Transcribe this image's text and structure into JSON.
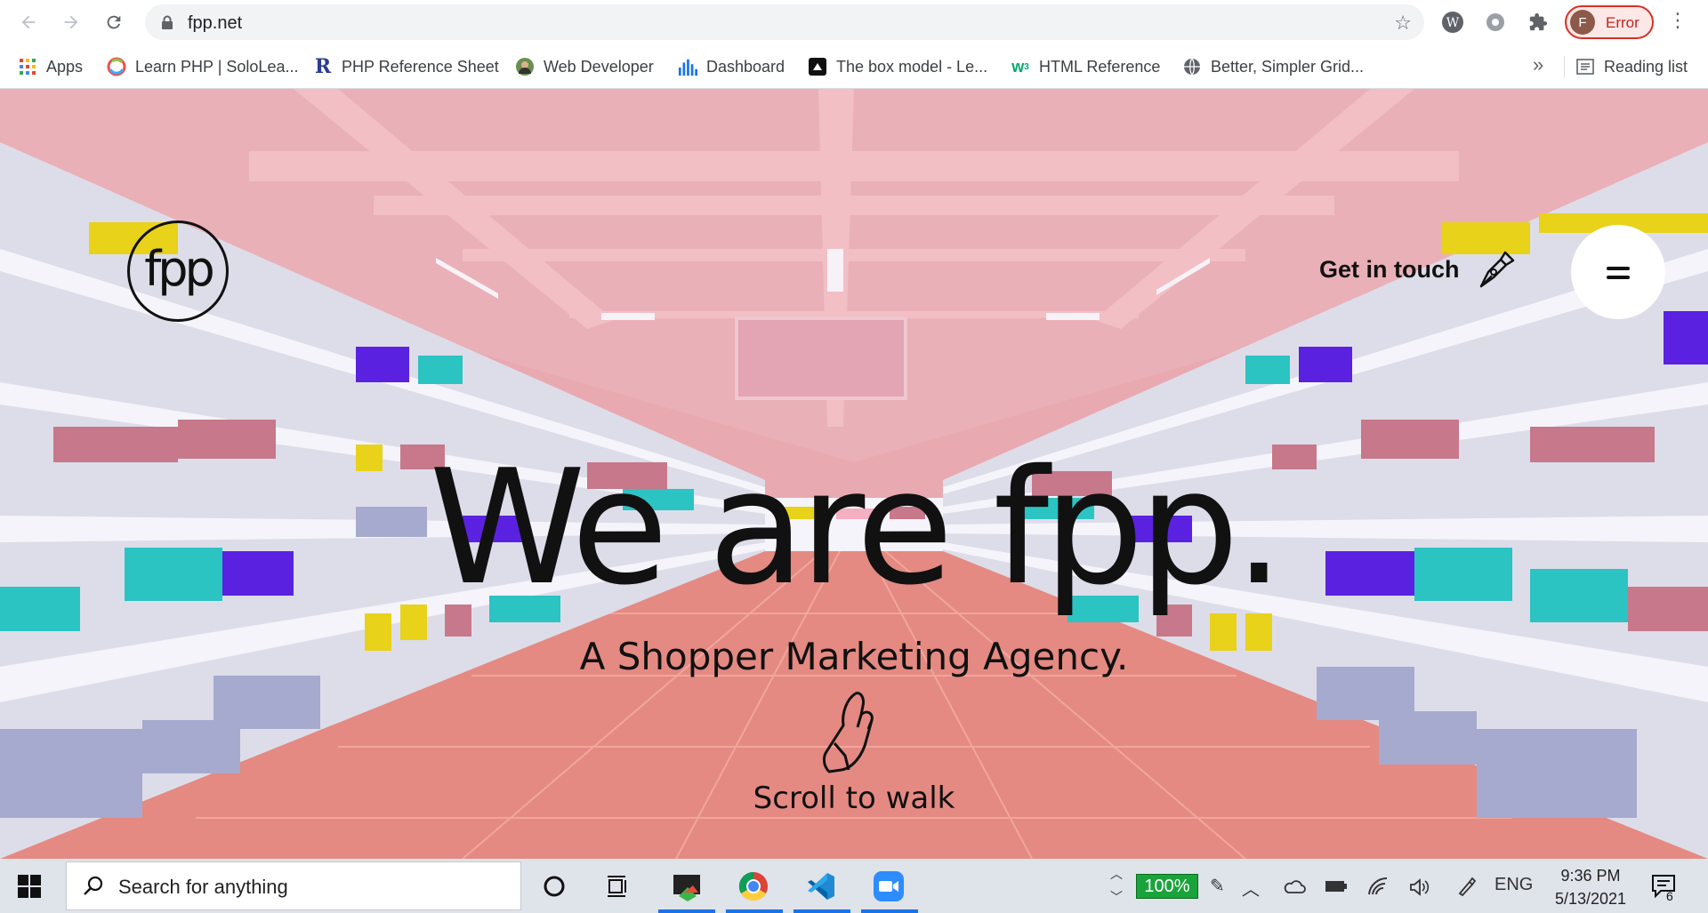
{
  "browser": {
    "url": "fpp.net",
    "profile_initial": "F",
    "profile_status": "Error",
    "bookmarks": [
      {
        "label": "Apps",
        "icon": "apps-grid-icon"
      },
      {
        "label": "Learn PHP | SoloLea...",
        "icon": "sololearn-icon"
      },
      {
        "label": "PHP Reference Sheet",
        "icon": "r-logo-icon"
      },
      {
        "label": "Web Developer",
        "icon": "avatar-icon"
      },
      {
        "label": "Dashboard",
        "icon": "bar-chart-icon"
      },
      {
        "label": "The box model - Le...",
        "icon": "codepen-icon"
      },
      {
        "label": "HTML Reference",
        "icon": "w3-icon"
      },
      {
        "label": "Better, Simpler Grid...",
        "icon": "globe-icon"
      }
    ],
    "more_bookmarks": "»",
    "reading_list": "Reading list"
  },
  "site": {
    "logo_text": "fpp",
    "get_in_touch": "Get in touch",
    "hero_title": "We are fpp.",
    "hero_subtitle": "A Shopper Marketing Agency.",
    "scroll_hint": "Scroll to walk"
  },
  "taskbar": {
    "search_placeholder": "Search for anything",
    "battery": "100%",
    "language": "ENG",
    "time": "9:36 PM",
    "date": "5/13/2021",
    "notification_count": "6"
  },
  "colors": {
    "ceiling": "#e9a9b1",
    "floor": "#e48a82",
    "shelf": "#eeeef6",
    "error_red": "#d93025",
    "battery_green": "#1aa33b"
  }
}
